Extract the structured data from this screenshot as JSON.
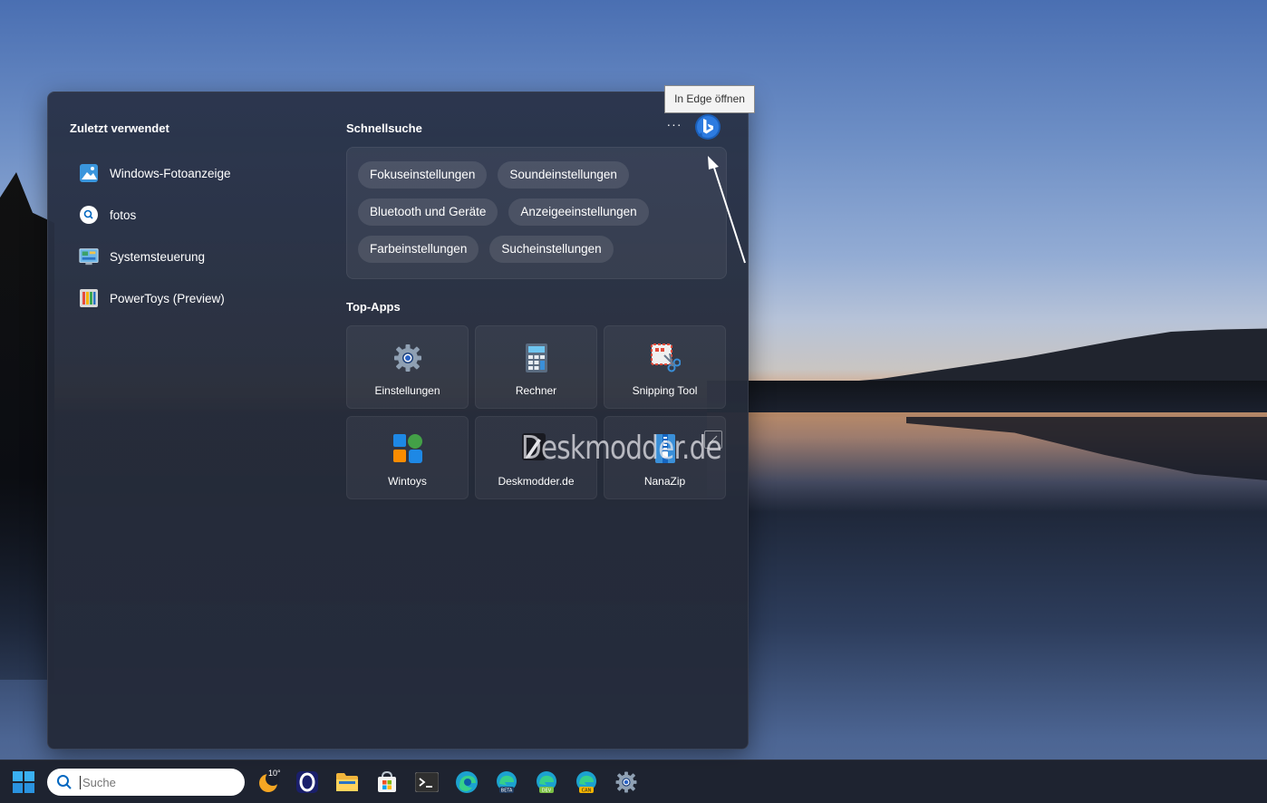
{
  "panel": {
    "recent_title": "Zuletzt verwendet",
    "recent_items": [
      {
        "label": "Windows-Fotoanzeige",
        "icon": "photos-viewer-icon"
      },
      {
        "label": "fotos",
        "icon": "search-icon"
      },
      {
        "label": "Systemsteuerung",
        "icon": "control-panel-icon"
      },
      {
        "label": "PowerToys (Preview)",
        "icon": "powertoys-icon"
      }
    ],
    "quick_title": "Schnellsuche",
    "more_label": "···",
    "quick_chips": [
      [
        "Fokuseinstellungen",
        "Soundeinstellungen"
      ],
      [
        "Bluetooth und Geräte",
        "Anzeigeeinstellungen"
      ],
      [
        "Farbeinstellungen",
        "Sucheinstellungen"
      ]
    ],
    "top_apps_title": "Top-Apps",
    "top_apps": [
      {
        "label": "Einstellungen",
        "icon": "settings-gear-icon"
      },
      {
        "label": "Rechner",
        "icon": "calculator-icon"
      },
      {
        "label": "Snipping Tool",
        "icon": "snipping-tool-icon"
      },
      {
        "label": "Wintoys",
        "icon": "wintoys-icon"
      },
      {
        "label": "Deskmodder.de",
        "icon": "deskmodder-icon"
      },
      {
        "label": "NanaZip",
        "icon": "nanazip-icon"
      }
    ]
  },
  "tooltip": {
    "text": "In Edge öffnen"
  },
  "watermark": {
    "text": "Deskmodder.de"
  },
  "taskbar": {
    "search_placeholder": "Suche",
    "weather_temp": "10°",
    "edge_badges": {
      "beta": "BETA",
      "dev": "DEV",
      "can": "CAN"
    }
  },
  "colors": {
    "accent": "#0078d4",
    "panel_bg": "#2a3246",
    "chip_bg": "#3c4356"
  }
}
